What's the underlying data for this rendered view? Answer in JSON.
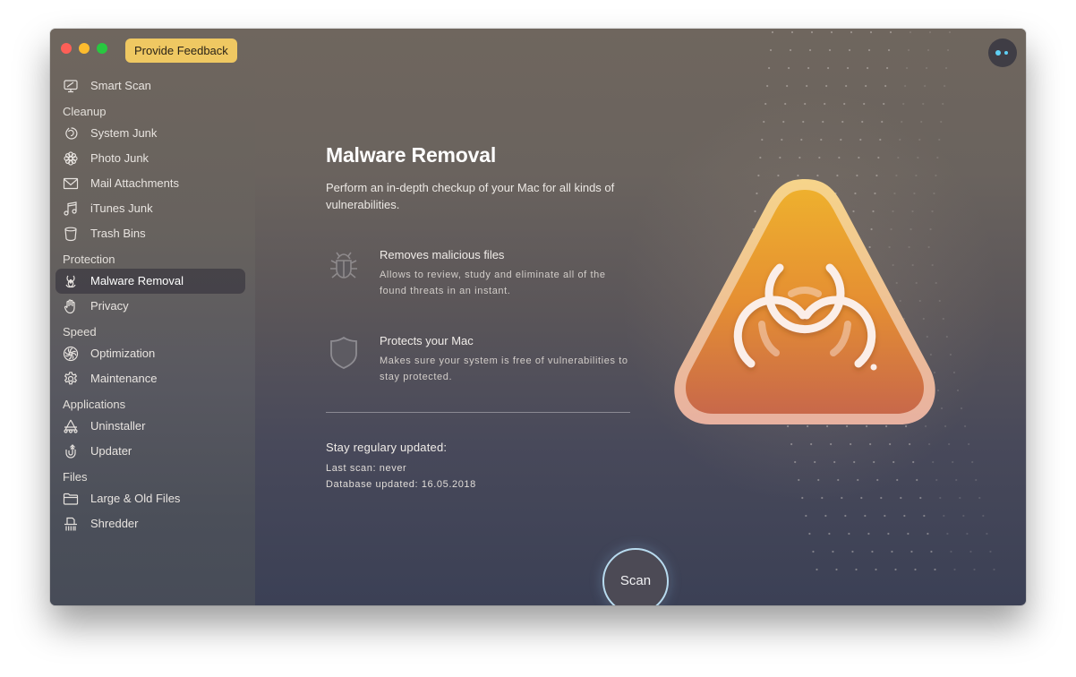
{
  "window": {
    "controls": [
      "close",
      "minimize",
      "maximize"
    ],
    "feedback_button": "Provide Feedback",
    "assistant_icon": "assistant-dots-icon"
  },
  "sidebar": {
    "top_item": {
      "label": "Smart Scan",
      "icon": "monitor-icon"
    },
    "sections": [
      {
        "title": "Cleanup",
        "items": [
          {
            "label": "System Junk",
            "icon": "system-junk-icon"
          },
          {
            "label": "Photo Junk",
            "icon": "flower-icon"
          },
          {
            "label": "Mail Attachments",
            "icon": "envelope-icon"
          },
          {
            "label": "iTunes Junk",
            "icon": "music-note-icon"
          },
          {
            "label": "Trash Bins",
            "icon": "trash-bin-icon"
          }
        ]
      },
      {
        "title": "Protection",
        "items": [
          {
            "label": "Malware Removal",
            "icon": "biohazard-icon",
            "active": true
          },
          {
            "label": "Privacy",
            "icon": "hand-icon"
          }
        ]
      },
      {
        "title": "Speed",
        "items": [
          {
            "label": "Optimization",
            "icon": "fan-icon"
          },
          {
            "label": "Maintenance",
            "icon": "gear-icon"
          }
        ]
      },
      {
        "title": "Applications",
        "items": [
          {
            "label": "Uninstaller",
            "icon": "uninstaller-icon"
          },
          {
            "label": "Updater",
            "icon": "updater-icon"
          }
        ]
      },
      {
        "title": "Files",
        "items": [
          {
            "label": "Large & Old Files",
            "icon": "folder-icon"
          },
          {
            "label": "Shredder",
            "icon": "shredder-icon"
          }
        ]
      }
    ]
  },
  "main": {
    "title": "Malware Removal",
    "subtitle": "Perform an in-depth checkup of your Mac for all kinds of vulnerabilities.",
    "features": [
      {
        "icon": "bug-icon",
        "heading": "Removes malicious files",
        "description": "Allows to review, study and eliminate all of the found threats in an instant."
      },
      {
        "icon": "shield-icon",
        "heading": "Protects your Mac",
        "description": "Makes sure your system is free of vulnerabilities to stay protected."
      }
    ],
    "updates": {
      "heading": "Stay regulary updated:",
      "last_scan": "Last scan: never",
      "database_updated": "Database updated: 16.05.2018"
    },
    "scan_button": "Scan"
  },
  "colors": {
    "feedback_button_bg": "#efc862",
    "hero_top": "#eeb02e",
    "hero_bottom": "#c8684a",
    "assistant_dot": "#5fd0f5",
    "scan_ring": "#b8dbef"
  }
}
